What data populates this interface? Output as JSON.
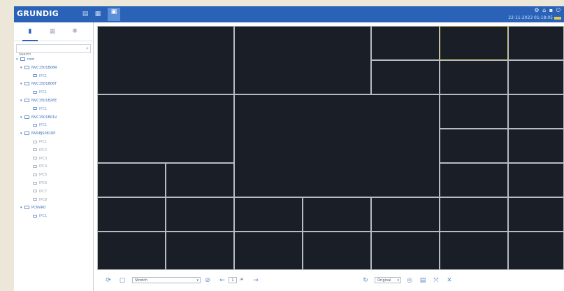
{
  "app": {
    "brand": "GRUNDIG",
    "top_icons": "▤ ▦ ▣",
    "top_right_icons": "⚙ ⌂ ▪ ⏻",
    "top_right_time": "22-11-2023 01:18:05"
  },
  "sidebar": {
    "tabs": [
      "device-list-icon",
      "image-icon",
      "settings-icon"
    ],
    "search_placeholder": "Search",
    "tree": [
      {
        "type": "root",
        "label": "root"
      },
      {
        "type": "device",
        "label": "NVC1501B06R"
      },
      {
        "type": "channel",
        "label": "IPC1"
      },
      {
        "type": "device",
        "label": "NVC1501B06T"
      },
      {
        "type": "channel",
        "label": "IPC1"
      },
      {
        "type": "device",
        "label": "NVC1501B26E"
      },
      {
        "type": "channel",
        "label": "IPC1"
      },
      {
        "type": "device",
        "label": "NVC1501B01V"
      },
      {
        "type": "channel",
        "label": "IPC1"
      },
      {
        "type": "device",
        "label": "NVR8JS0818P"
      },
      {
        "type": "channel",
        "label": "IPC1"
      },
      {
        "type": "channel",
        "label": "IPC2"
      },
      {
        "type": "channel",
        "label": "IPC3"
      },
      {
        "type": "channel",
        "label": "IPC4"
      },
      {
        "type": "channel",
        "label": "IPC5"
      },
      {
        "type": "channel",
        "label": "IPC6"
      },
      {
        "type": "channel",
        "label": "IPC7"
      },
      {
        "type": "channel",
        "label": "IPC8"
      },
      {
        "type": "device",
        "label": "PCNVR0"
      },
      {
        "type": "channel",
        "label": "IPC1"
      }
    ]
  },
  "toolbar": {
    "layout_select": "Stretch",
    "page_current": "1",
    "page_total": "/4",
    "stream_select": "Original"
  },
  "colors": {
    "topbar": "#2a62b8",
    "video_bg": "#1a1e26",
    "grid_line": "#b7bcc4",
    "selected_tile": "#d8c86a",
    "tree_text": "#3a6fb8"
  }
}
